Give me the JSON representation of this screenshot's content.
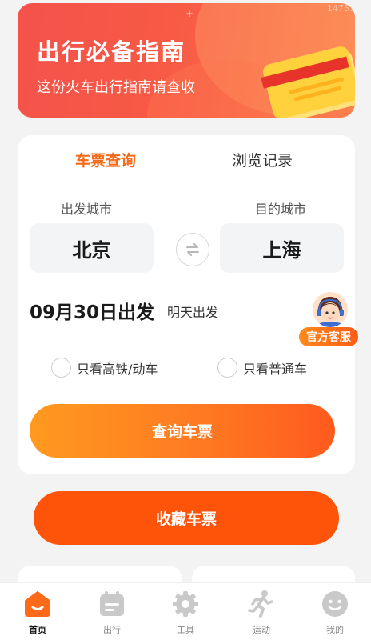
{
  "banner": {
    "title": "出行必备指南",
    "subtitle": "这份火车出行指南请查收",
    "watermark": "14751"
  },
  "tabs": {
    "ticket_query": "车票查询",
    "history": "浏览记录",
    "active": "ticket_query"
  },
  "route": {
    "from_label": "出发城市",
    "from_city": "北京",
    "to_label": "目的城市",
    "to_city": "上海"
  },
  "date": {
    "value": "09月30日出发",
    "hint": "明天出发"
  },
  "customer_service": {
    "label": "官方客服"
  },
  "filters": {
    "high_speed": "只看高铁/动车",
    "regular": "只看普通车"
  },
  "buttons": {
    "query": "查询车票",
    "favorite": "收藏车票"
  },
  "bottom_nav": {
    "home": "首页",
    "trip": "出行",
    "tools": "工具",
    "sport": "运动",
    "mine": "我的"
  },
  "colors": {
    "accent": "#ff6a1a",
    "banner_red": "#f4524b",
    "icon_grey": "#c9c9c9"
  },
  "icons": {
    "swap": "swap-arrows-icon",
    "home": "home-icon",
    "trip": "calendar-icon",
    "tools": "gear-icon",
    "sport": "running-person-icon",
    "mine": "smiley-face-icon"
  }
}
